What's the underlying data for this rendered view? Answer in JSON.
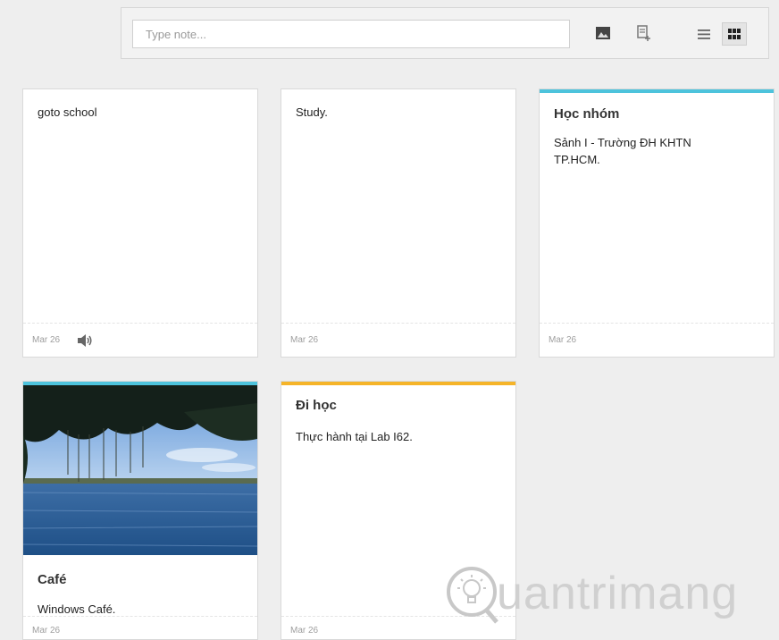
{
  "toolbar": {
    "input_placeholder": "Type note...",
    "add_image_icon": "image-icon",
    "add_list_icon": "add-list-icon",
    "list_view_icon": "list-view-icon",
    "grid_view_icon": "grid-view-icon"
  },
  "colors": {
    "background": "#eeeeee",
    "accent_blue": "#4dc3dc",
    "accent_yellow": "#f5b429",
    "date_text": "#9e9e9e"
  },
  "notes": [
    {
      "title": "",
      "text": "goto school",
      "date": "Mar 26",
      "has_audio": true
    },
    {
      "title": "",
      "text": "Study.",
      "date": "Mar 26"
    },
    {
      "title": "Học nhóm",
      "text": "Sảnh I - Trường ĐH KHTN TP.HCM.",
      "date": "Mar 26",
      "accent": "blue"
    },
    {
      "title": "Café",
      "text": "Windows Café.",
      "date": "Mar 26",
      "accent": "blue",
      "has_image": true
    },
    {
      "title": "Đi học",
      "text": "Thực hành tại Lab I62.",
      "date": "Mar 26",
      "accent": "yellow"
    }
  ],
  "watermark": {
    "text": "uantrimang",
    "logo_icon": "lightbulb-q-icon"
  }
}
